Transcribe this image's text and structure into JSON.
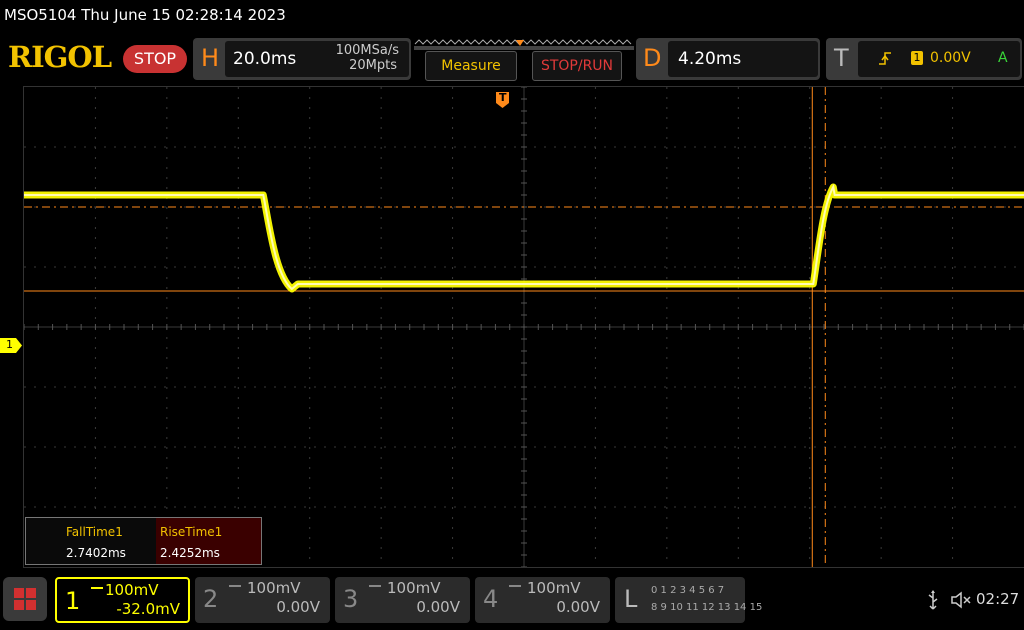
{
  "title_bar": {
    "text": "MSO5104  Thu June 15 02:28:14 2023"
  },
  "header": {
    "logo": "RIGOL",
    "run_state": "STOP",
    "horizontal": {
      "letter": "H",
      "timebase": "20.0ms",
      "sample_rate": "100MSa/s",
      "memory_depth": "20Mpts"
    },
    "measure_label": "Measure",
    "stop_run_label": "STOP/RUN",
    "delay": {
      "letter": "D",
      "value": "4.20ms"
    },
    "trigger": {
      "letter": "T",
      "source": "1",
      "level": "0.00V",
      "mode": "A"
    }
  },
  "colors": {
    "ch1": "#ffff00",
    "accent": "#ff8a1a",
    "stop": "#c83232",
    "cursor": "#ff8a1a"
  },
  "plot": {
    "ch1_marker": "1",
    "trigger_marker": "T",
    "signal": {
      "high_level_div": 2.2,
      "low_level_div": 0.7,
      "fall_start_div": 3.35,
      "fall_end_div": 3.75,
      "rise_start_div": 11.05,
      "rise_end_div": 11.35
    }
  },
  "measurements": {
    "items": [
      {
        "label": "FallTime1",
        "value": "2.7402ms"
      },
      {
        "label": "RiseTime1",
        "value": "2.4252ms"
      }
    ]
  },
  "channels": [
    {
      "number": "1",
      "scale": "100mV",
      "offset": "-32.0mV",
      "active": true
    },
    {
      "number": "2",
      "scale": "100mV",
      "offset": "0.00V",
      "active": false
    },
    {
      "number": "3",
      "scale": "100mV",
      "offset": "0.00V",
      "active": false
    },
    {
      "number": "4",
      "scale": "100mV",
      "offset": "0.00V",
      "active": false
    }
  ],
  "logic": {
    "letter": "L",
    "row1": "0 1 2 3  4 5 6 7",
    "row2": "8 9 10 11 12 13 14 15"
  },
  "status": {
    "clock": "02:27",
    "usb_icon": "usb-icon",
    "sound_icon": "mute-icon"
  }
}
